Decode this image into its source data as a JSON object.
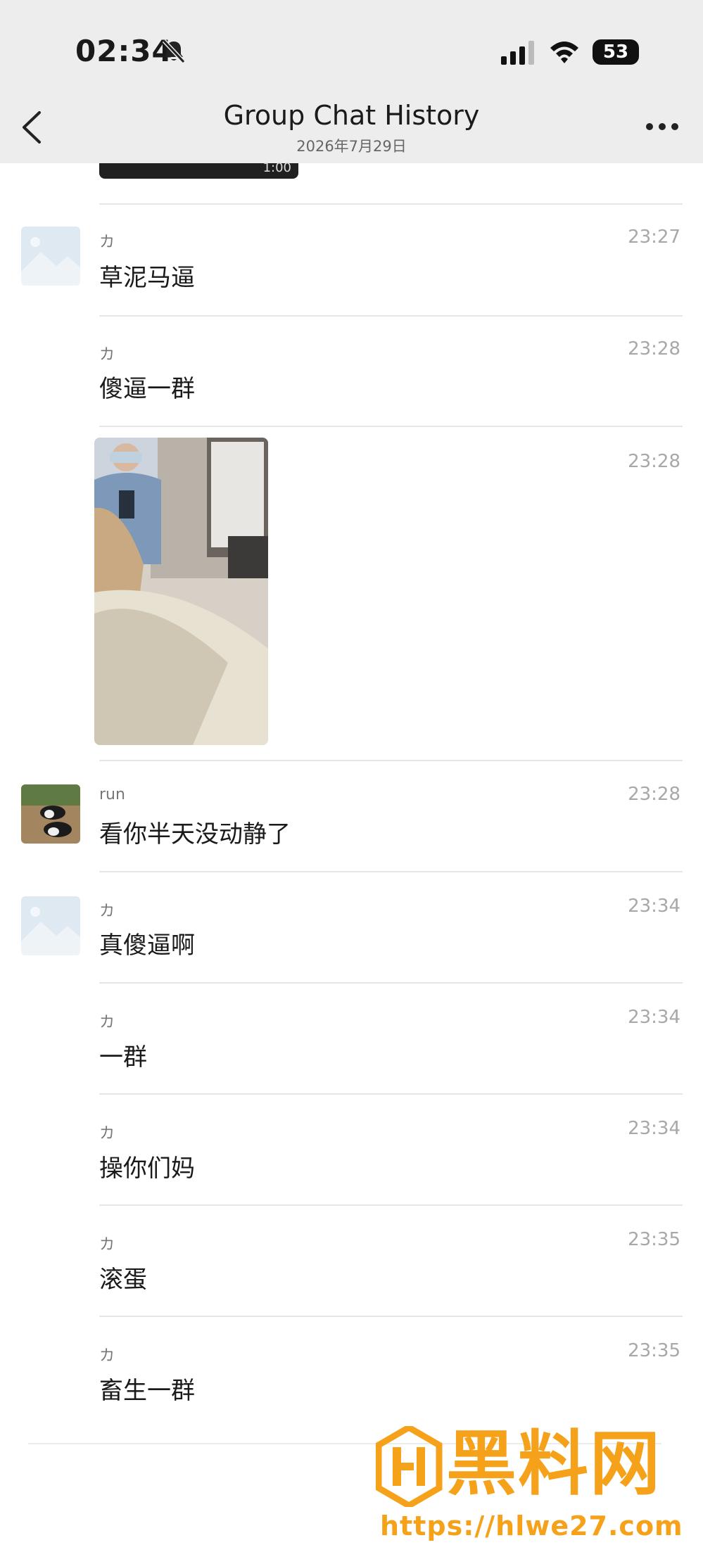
{
  "status_bar": {
    "time": "02:34",
    "battery_level": "53"
  },
  "header": {
    "title": "Group Chat History",
    "subtitle": "2026年7月29日"
  },
  "media_stub": {
    "duration": "1:00"
  },
  "messages": [
    {
      "sender": "カ",
      "time": "23:27",
      "text": "草泥马逼"
    },
    {
      "sender": "カ",
      "time": "23:28",
      "text": "傻逼一群"
    },
    {
      "time": "23:28"
    },
    {
      "sender": "run",
      "time": "23:28",
      "text": "看你半天没动静了"
    },
    {
      "sender": "カ",
      "time": "23:34",
      "text": "真傻逼啊"
    },
    {
      "sender": "カ",
      "time": "23:34",
      "text": "一群"
    },
    {
      "sender": "カ",
      "time": "23:34",
      "text": "操你们妈"
    },
    {
      "sender": "カ",
      "time": "23:35",
      "text": "滚蛋"
    },
    {
      "sender": "カ",
      "time": "23:35",
      "text": "畜生一群"
    }
  ],
  "icons": {
    "back": "chevron-left-icon",
    "more": "more-dots-icon",
    "mute": "bell-slash-icon",
    "signal": "signal-icon",
    "wifi": "wifi-icon"
  },
  "watermark": {
    "name": "黑料网",
    "url": "https://hlwe27.com"
  },
  "colors": {
    "topbar": "#ededed",
    "timestamp": "#a8a8a8",
    "watermark": "#f5a21a"
  }
}
